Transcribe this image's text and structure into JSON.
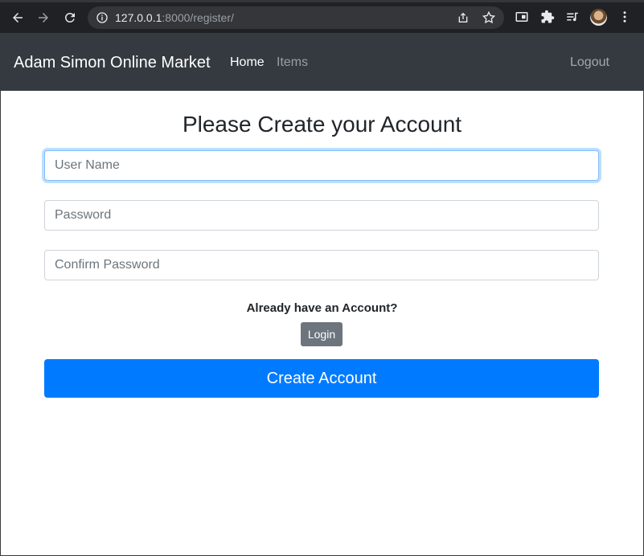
{
  "browser": {
    "url_host": "127.0.0.1",
    "url_rest": ":8000/register/",
    "icons": [
      "back-icon",
      "forward-icon",
      "reload-icon",
      "info-icon",
      "share-icon",
      "star-icon",
      "sidepanel-icon",
      "extensions-icon",
      "media-icon",
      "profile-avatar",
      "menu-icon"
    ]
  },
  "navbar": {
    "brand": "Adam Simon Online Market",
    "links": [
      {
        "label": "Home"
      },
      {
        "label": "Items"
      }
    ],
    "logout": "Logout",
    "bg_color": "#343a40"
  },
  "form": {
    "title": "Please Create your Account",
    "username_placeholder": "User Name",
    "password_placeholder": "Password",
    "confirm_placeholder": "Confirm Password",
    "already_text": "Already have an Account?",
    "login_label": "Login",
    "submit_label": "Create Account",
    "primary_color": "#007bff",
    "secondary_color": "#6c757d"
  }
}
